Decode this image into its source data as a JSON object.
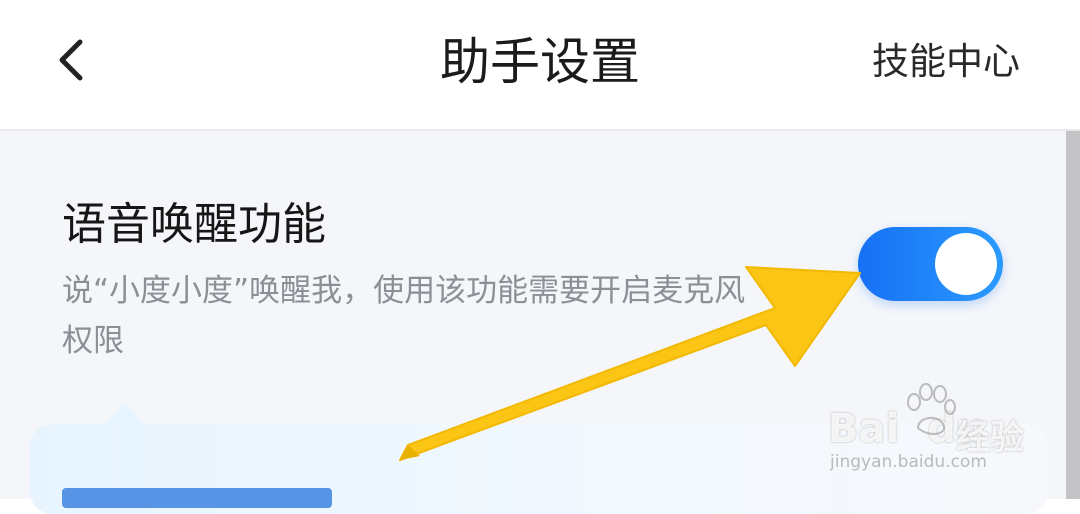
{
  "header": {
    "title": "助手设置",
    "right_link": "技能中心",
    "back_icon": "chevron-left-icon"
  },
  "setting": {
    "title": "语音唤醒功能",
    "description": "说“小度小度”唤醒我，使用该功能需要开启麦克风权限",
    "toggle_on": true
  },
  "watermark": {
    "brand_a": "Bai",
    "brand_b": "du",
    "brand_cn": "经验",
    "url": "jingyan.baidu.com"
  },
  "colors": {
    "toggle_accent": "#1a7af8",
    "annotation_arrow": "#fac515",
    "description_text": "#8c8f96"
  }
}
